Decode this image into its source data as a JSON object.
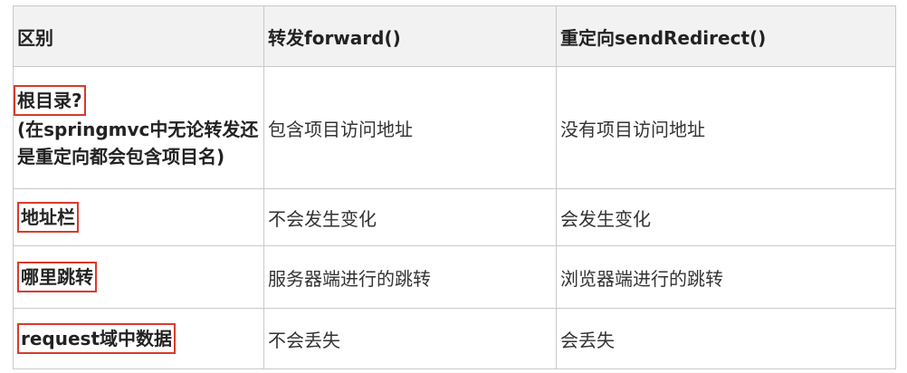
{
  "table": {
    "headers": [
      "区别",
      "转发forward()",
      "重定向sendRedirect()"
    ],
    "rows": [
      {
        "label": "根目录?",
        "note": "(在springmvc中无论转发还是重定向都会包含项目名)",
        "forward": "包含项目访问地址",
        "redirect": "没有项目访问地址"
      },
      {
        "label": "地址栏",
        "forward": "不会发生变化",
        "redirect": "会发生变化"
      },
      {
        "label": "哪里跳转",
        "forward": "服务器端进行的跳转",
        "redirect": "浏览器端进行的跳转"
      },
      {
        "label": "request域中数据",
        "forward": "不会丢失",
        "redirect": "会丢失"
      }
    ]
  },
  "highlight_color": "#d93a2b"
}
